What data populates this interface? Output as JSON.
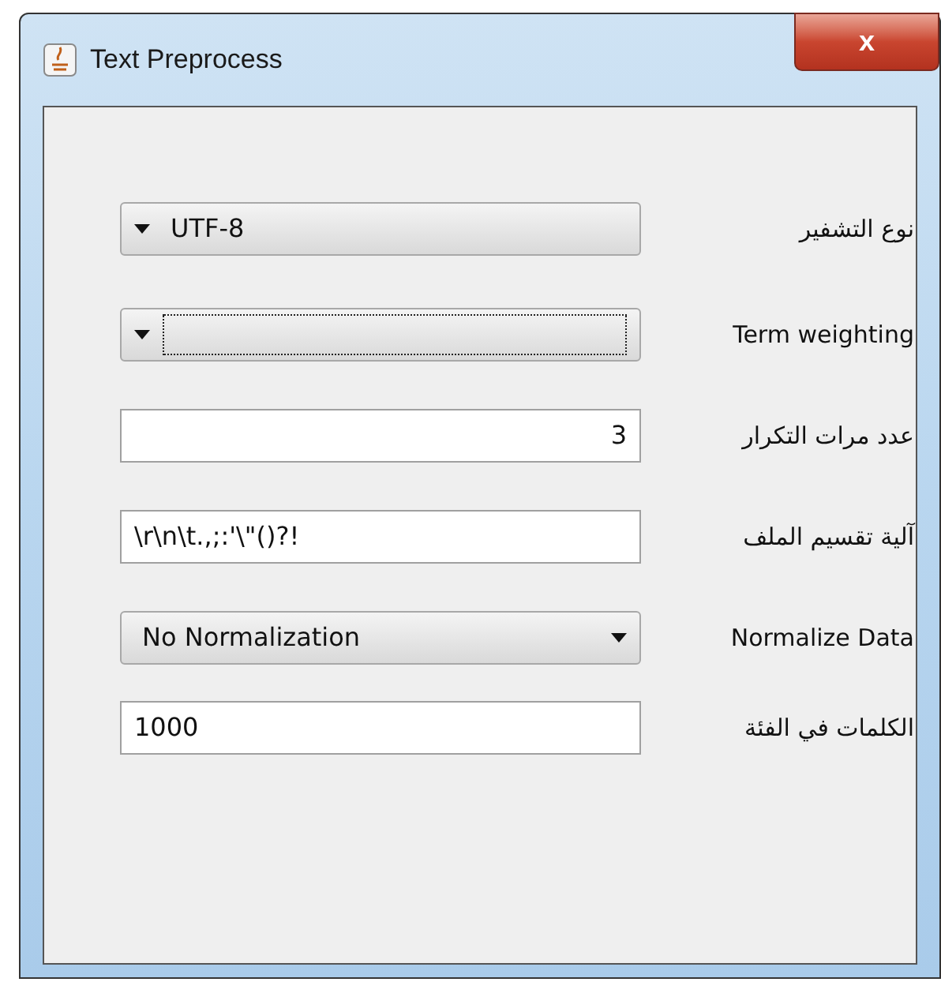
{
  "window": {
    "title": "Text Preprocess",
    "close": "x"
  },
  "rows": [
    {
      "label": "نوع التشفير",
      "kind": "combo",
      "value": "UTF-8",
      "rtl": true,
      "focused": false
    },
    {
      "label": "Term weighting",
      "kind": "combo",
      "rtl": true,
      "focused": true
    },
    {
      "label": "عدد مرات التكرار",
      "kind": "text",
      "value": "3",
      "rtl": true
    },
    {
      "label": "آلية تقسيم الملف",
      "kind": "text",
      "value": "\\r\\n\\t.,;:'\\\"()?!",
      "rtl": false
    },
    {
      "label": "Normalize Data",
      "kind": "combo",
      "value": "No Normalization",
      "rtl": false,
      "focused": false
    },
    {
      "label": "الكلمات في الفئة",
      "kind": "text",
      "value": "1000",
      "rtl": false
    }
  ]
}
